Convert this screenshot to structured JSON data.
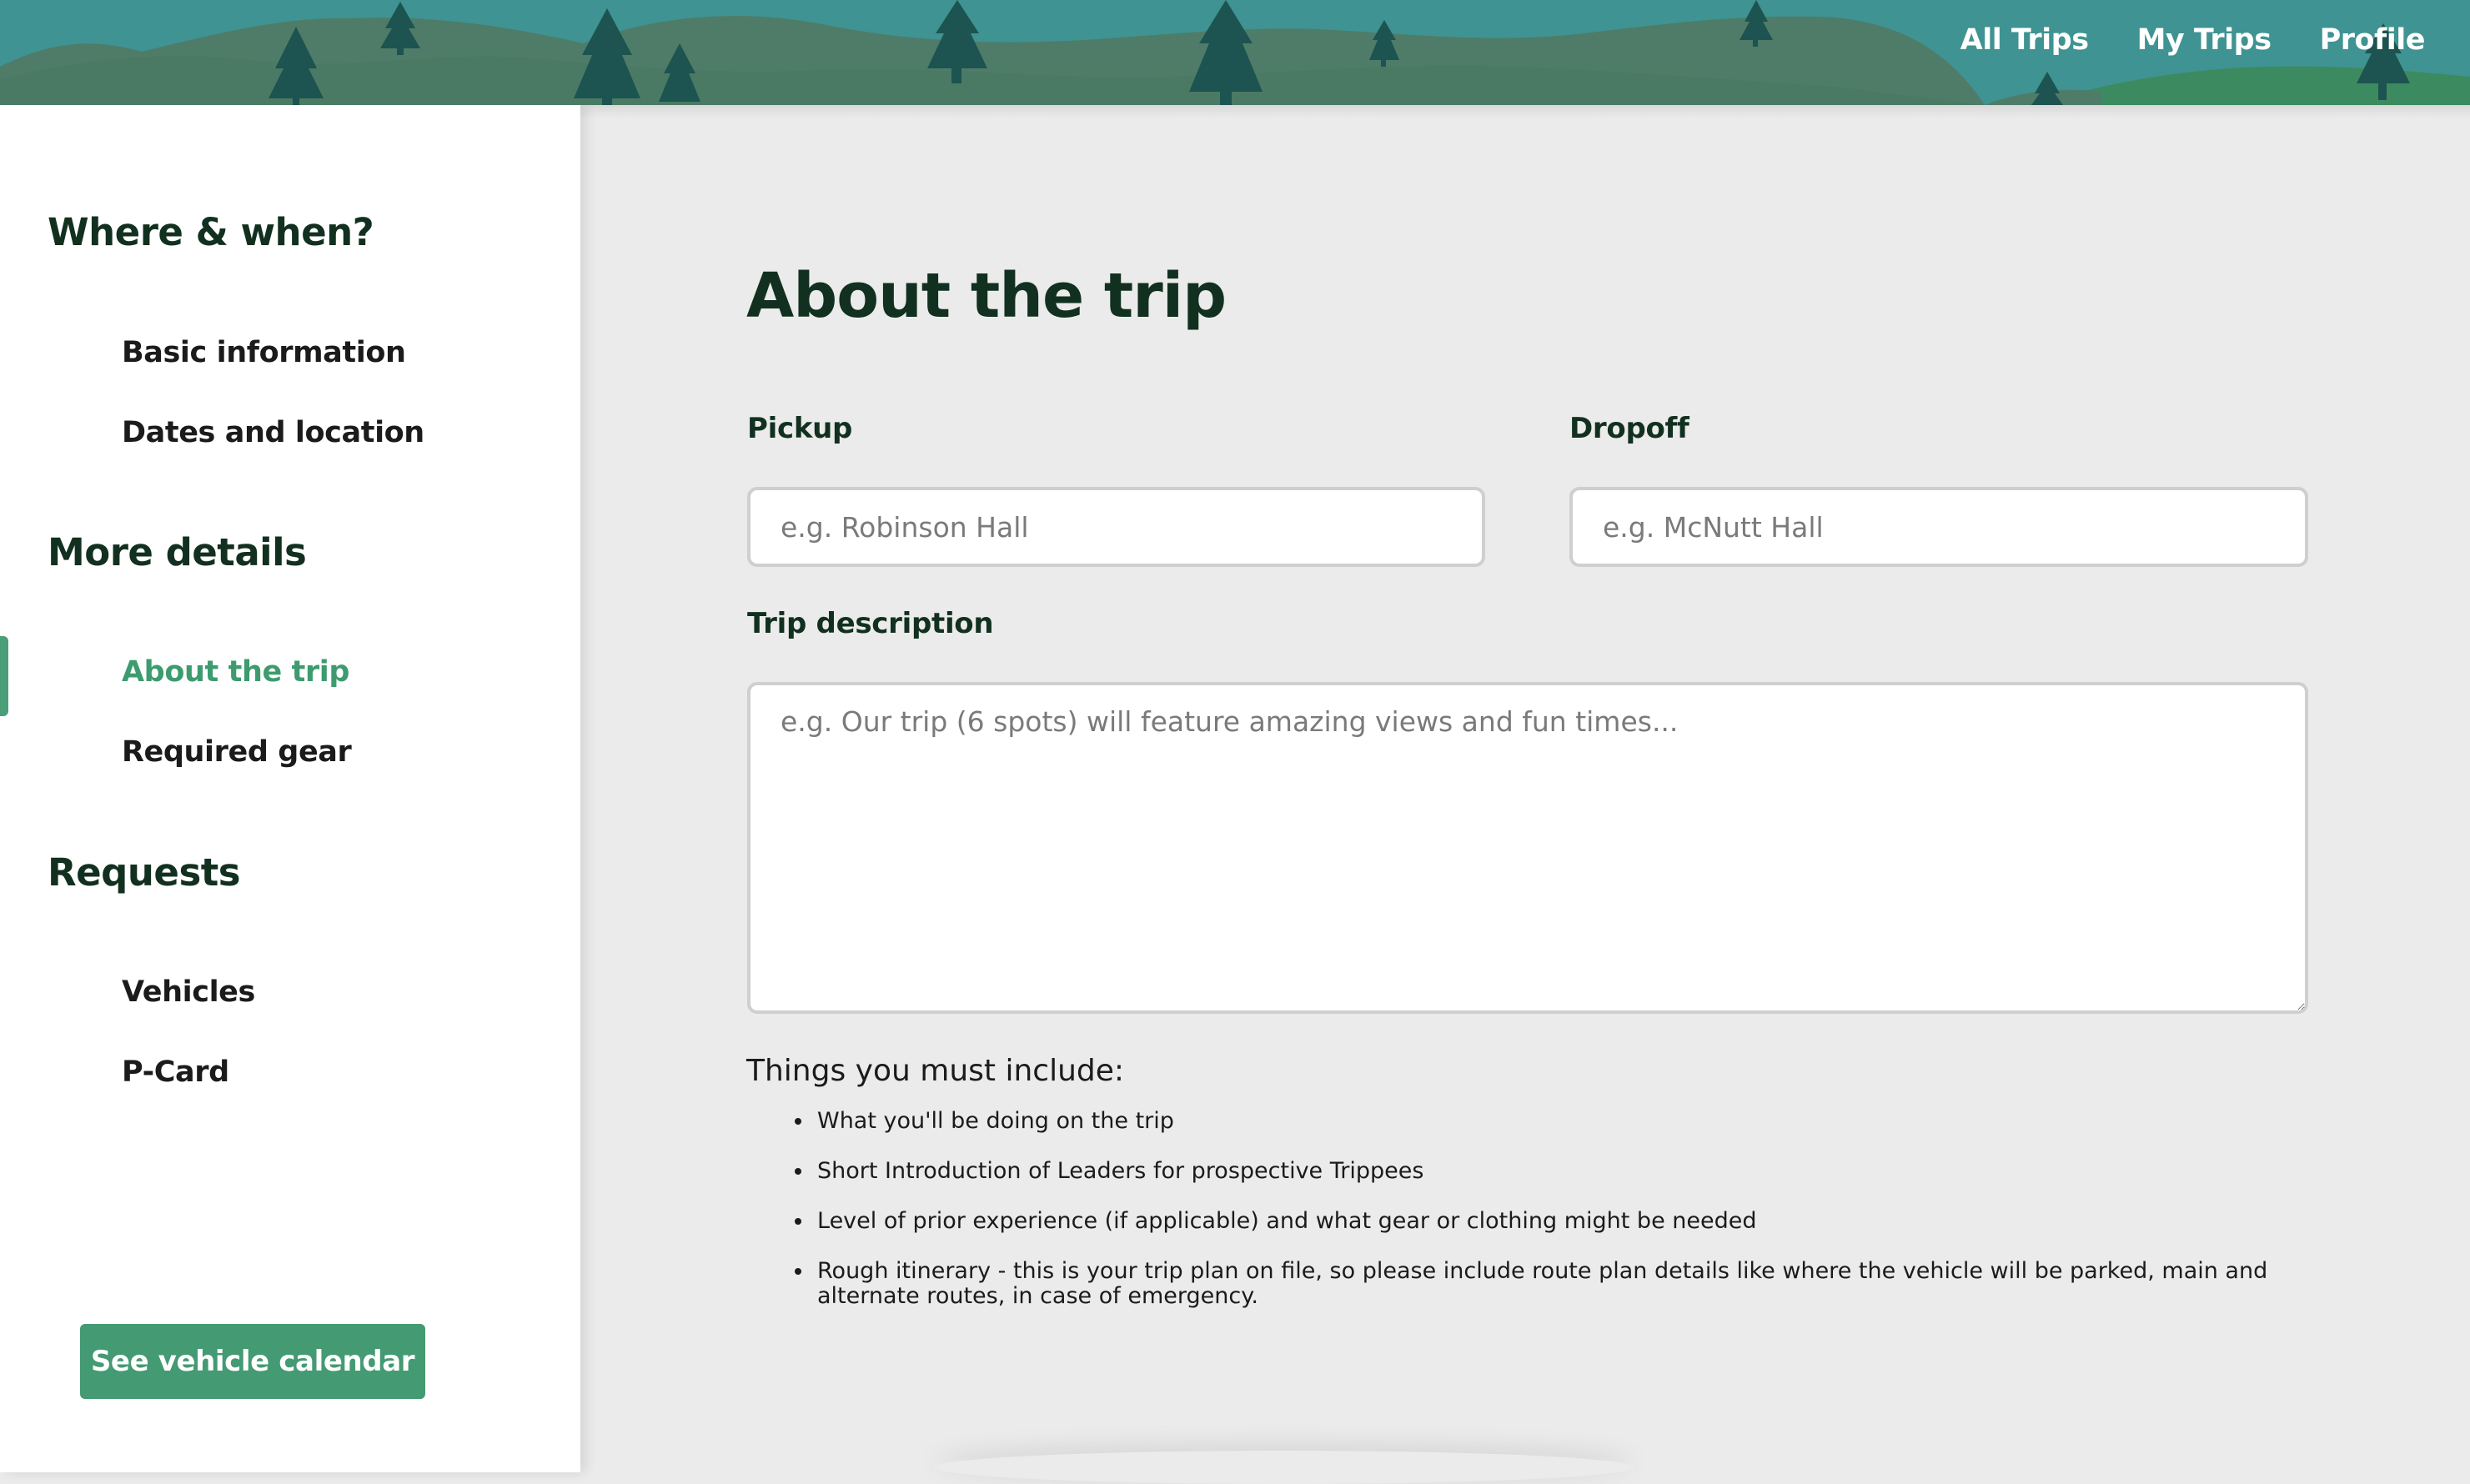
{
  "header": {
    "nav": [
      "All Trips",
      "My Trips",
      "Profile"
    ]
  },
  "sidebar": {
    "sections": [
      {
        "title": "Where & when?",
        "items": [
          "Basic information",
          "Dates and location"
        ]
      },
      {
        "title": "More details",
        "items": [
          "About the trip",
          "Required gear"
        ]
      },
      {
        "title": "Requests",
        "items": [
          "Vehicles",
          "P-Card"
        ]
      }
    ],
    "active_item": "About the trip",
    "calendar_button": "See vehicle calendar"
  },
  "main": {
    "title": "About the trip",
    "pickup": {
      "label": "Pickup",
      "placeholder": "e.g. Robinson Hall",
      "value": ""
    },
    "dropoff": {
      "label": "Dropoff",
      "placeholder": "e.g. McNutt Hall",
      "value": ""
    },
    "description": {
      "label": "Trip description",
      "placeholder": "e.g. Our trip (6 spots) will feature amazing views and fun times...",
      "value": ""
    },
    "must_include_heading": "Things you must include:",
    "must_include": [
      "What you'll be doing on the trip",
      "Short Introduction of Leaders for prospective Trippees",
      "Level of prior experience (if applicable) and what gear or clothing might be needed",
      "Rough itinerary - this is your trip plan on file, so please include route plan details like where the vehicle will be parked, main and alternate routes, in case of emergency."
    ]
  },
  "colors": {
    "header_bg": "#3f9392",
    "hills": "#4e7c68",
    "hills_light": "#3c8a5f",
    "trees": "#1d5350",
    "accent": "#449a72",
    "heading": "#12301f"
  },
  "icons": {
    "header_scenery": "mountains-trees-icon"
  }
}
